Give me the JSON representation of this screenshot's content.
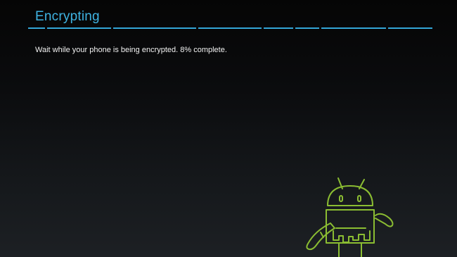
{
  "screen": {
    "title": "Encrypting",
    "message": "Wait while your phone is being encrypted. 8% complete.",
    "progress_percent": 8,
    "accent_color": "#33a6d7",
    "robot_color": "#8bbd32"
  }
}
